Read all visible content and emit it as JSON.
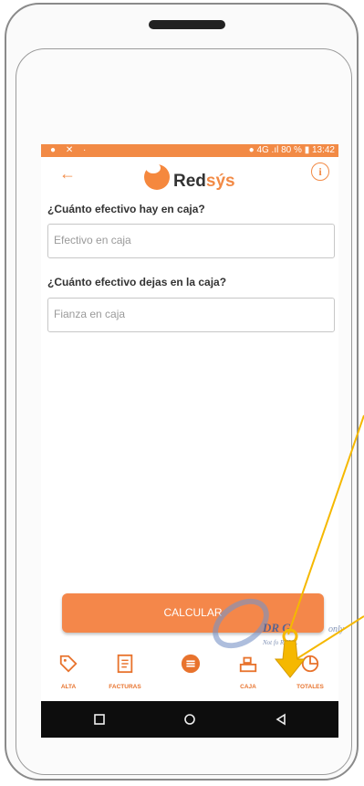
{
  "status": {
    "left_icons": "● ✕ ·",
    "right_text": "● 4G .ıl  80 % ▮ 13:42"
  },
  "header": {
    "logo_text_main": "Red",
    "logo_text_accent": "sýs",
    "back_icon": "arrow-left-icon",
    "info_icon": "info-icon"
  },
  "form": {
    "q1_label": "¿Cuánto efectivo hay en caja?",
    "q1_placeholder": "Efectivo en caja",
    "q2_label": "¿Cuánto efectivo dejas en la caja?",
    "q2_placeholder": "Fianza en caja",
    "calculate_label": "CALCULAR"
  },
  "tabs": [
    {
      "label": "ALTA",
      "icon": "tag-icon"
    },
    {
      "label": "FACTURAS",
      "icon": "invoice-icon"
    },
    {
      "label": "",
      "icon": "menu-circle-icon"
    },
    {
      "label": "CAJA",
      "icon": "cash-register-icon"
    },
    {
      "label": "TOTALES",
      "icon": "pie-chart-icon"
    }
  ],
  "watermark": {
    "brand_fragment": "DR   G",
    "line2": "only",
    "line3": "Not fo      RCIAL"
  },
  "colors": {
    "accent": "#f28a45",
    "pointer": "#f5b800"
  }
}
